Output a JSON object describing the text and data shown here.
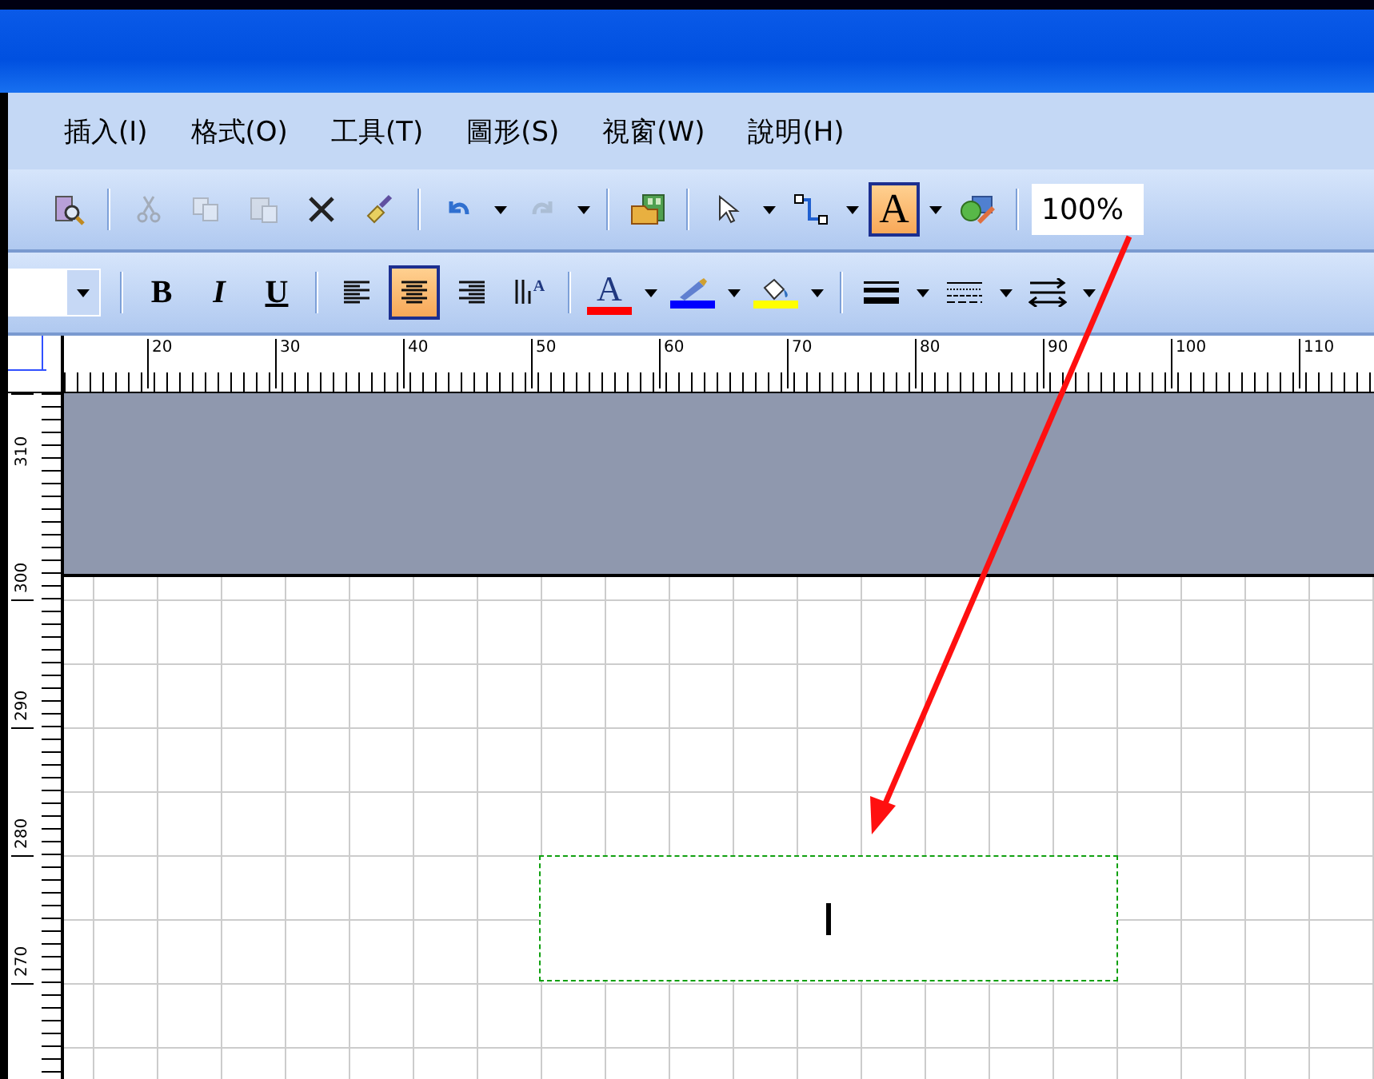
{
  "menu": [
    {
      "label": "插入(I)"
    },
    {
      "label": "格式(O)"
    },
    {
      "label": "工具(T)"
    },
    {
      "label": "圖形(S)"
    },
    {
      "label": "視窗(W)"
    },
    {
      "label": "說明(H)"
    }
  ],
  "standard_toolbar": [
    {
      "kind": "preview",
      "disabled": false,
      "selected": false
    },
    {
      "kind": "separator"
    },
    {
      "kind": "cut",
      "disabled": true,
      "selected": false
    },
    {
      "kind": "copy",
      "disabled": true,
      "selected": false
    },
    {
      "kind": "paste",
      "disabled": true,
      "selected": false
    },
    {
      "kind": "delete",
      "disabled": false,
      "selected": false
    },
    {
      "kind": "format-painter",
      "disabled": false,
      "selected": false
    },
    {
      "kind": "separator"
    },
    {
      "kind": "undo",
      "disabled": false,
      "selected": false,
      "dropdown": true
    },
    {
      "kind": "redo",
      "disabled": true,
      "selected": false,
      "dropdown": true
    },
    {
      "kind": "separator"
    },
    {
      "kind": "shapes",
      "disabled": false,
      "selected": false
    },
    {
      "kind": "separator"
    },
    {
      "kind": "pointer",
      "disabled": false,
      "selected": false,
      "dropdown": true
    },
    {
      "kind": "connector",
      "disabled": false,
      "selected": false,
      "dropdown": true
    },
    {
      "kind": "text",
      "glyph": "A",
      "disabled": false,
      "selected": true,
      "dropdown": true
    },
    {
      "kind": "stencil",
      "disabled": false,
      "selected": false
    },
    {
      "kind": "separator"
    },
    {
      "kind": "zoom",
      "value": "100%"
    }
  ],
  "formatting_toolbar": [
    {
      "kind": "font-size"
    },
    {
      "kind": "separator"
    },
    {
      "kind": "bold",
      "glyph": "B",
      "selected": false
    },
    {
      "kind": "italic",
      "glyph": "I",
      "selected": false
    },
    {
      "kind": "underline",
      "glyph": "U",
      "selected": false
    },
    {
      "kind": "separator"
    },
    {
      "kind": "align-left",
      "selected": false
    },
    {
      "kind": "align-center",
      "selected": true
    },
    {
      "kind": "align-right",
      "selected": false
    },
    {
      "kind": "vertical-align",
      "glyph": "A",
      "selected": false
    },
    {
      "kind": "separator"
    },
    {
      "kind": "font-color",
      "glyph": "A",
      "color": "#ff0000",
      "selected": false
    },
    {
      "kind": "line-color",
      "color": "#0000ff",
      "selected": false
    },
    {
      "kind": "fill-color",
      "color": "#ffff00",
      "selected": false
    },
    {
      "kind": "separator"
    },
    {
      "kind": "line-weight",
      "selected": false
    },
    {
      "kind": "line-pattern",
      "selected": false
    },
    {
      "kind": "line-ends",
      "selected": false
    }
  ],
  "horizontal_ruler": [
    "20",
    "30",
    "40",
    "50",
    "60",
    "70",
    "80",
    "90",
    "100",
    "110"
  ],
  "vertical_ruler": [
    "310",
    "300",
    "290",
    "280",
    "270"
  ]
}
